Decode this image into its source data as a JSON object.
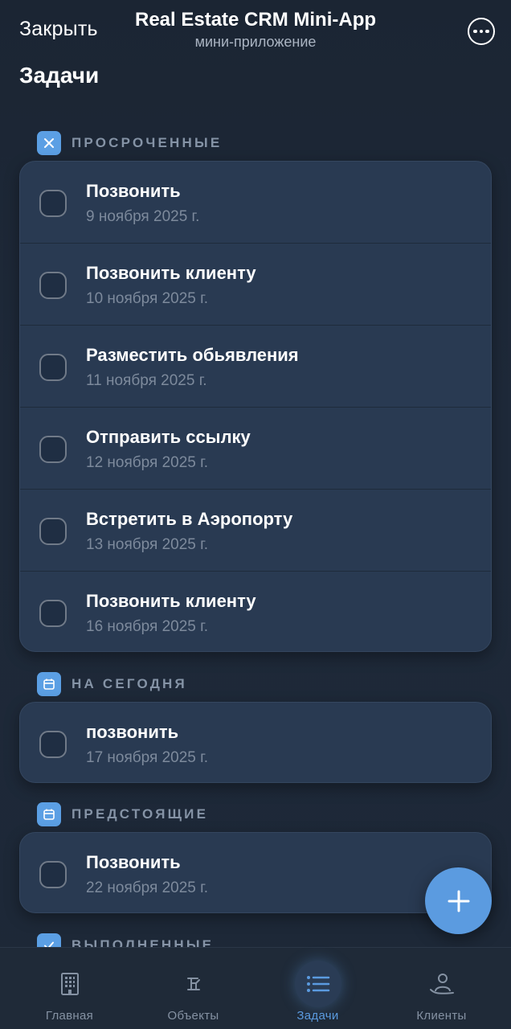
{
  "header": {
    "close_label": "Закрыть",
    "title": "Real Estate CRM Mini-App",
    "subtitle": "мини-приложение",
    "menu_icon": "more-horizontal-icon"
  },
  "page": {
    "title": "Задачи"
  },
  "sections": {
    "overdue": {
      "label": "ПРОСРОЧЕННЫЕ",
      "icon": "x-icon",
      "tasks": [
        {
          "title": "Позвонить",
          "date": "9 ноября 2025 г."
        },
        {
          "title": "Позвонить клиенту",
          "date": "10 ноября 2025 г."
        },
        {
          "title": "Разместить обьявления",
          "date": "11 ноября 2025 г."
        },
        {
          "title": "Отправить ссылку",
          "date": "12 ноября 2025 г."
        },
        {
          "title": "Встретить в Аэропорту",
          "date": "13 ноября 2025 г."
        },
        {
          "title": "Позвонить клиенту",
          "date": "16 ноября 2025 г."
        }
      ]
    },
    "today": {
      "label": "НА СЕГОДНЯ",
      "icon": "calendar-icon",
      "tasks": [
        {
          "title": "позвонить",
          "date": "17 ноября 2025 г."
        }
      ]
    },
    "upcoming": {
      "label": "ПРЕДСТОЯЩИЕ",
      "icon": "calendar-icon",
      "tasks": [
        {
          "title": "Позвонить",
          "date": "22 ноября 2025 г."
        }
      ]
    },
    "done": {
      "label": "ВЫПОЛНЕННЫЕ",
      "icon": "check-icon"
    }
  },
  "fab": {
    "icon": "plus-icon"
  },
  "bottom_nav": {
    "items": [
      {
        "label": "Главная",
        "icon": "building-icon",
        "active": false
      },
      {
        "label": "Объекты",
        "icon": "property-icon",
        "active": false
      },
      {
        "label": "Задачи",
        "icon": "list-icon",
        "active": true
      },
      {
        "label": "Клиенты",
        "icon": "client-icon",
        "active": false
      }
    ]
  },
  "colors": {
    "accent": "#5b9be0",
    "background": "#1c2736",
    "card": "#293a52",
    "muted_text": "#7d8a9c"
  }
}
